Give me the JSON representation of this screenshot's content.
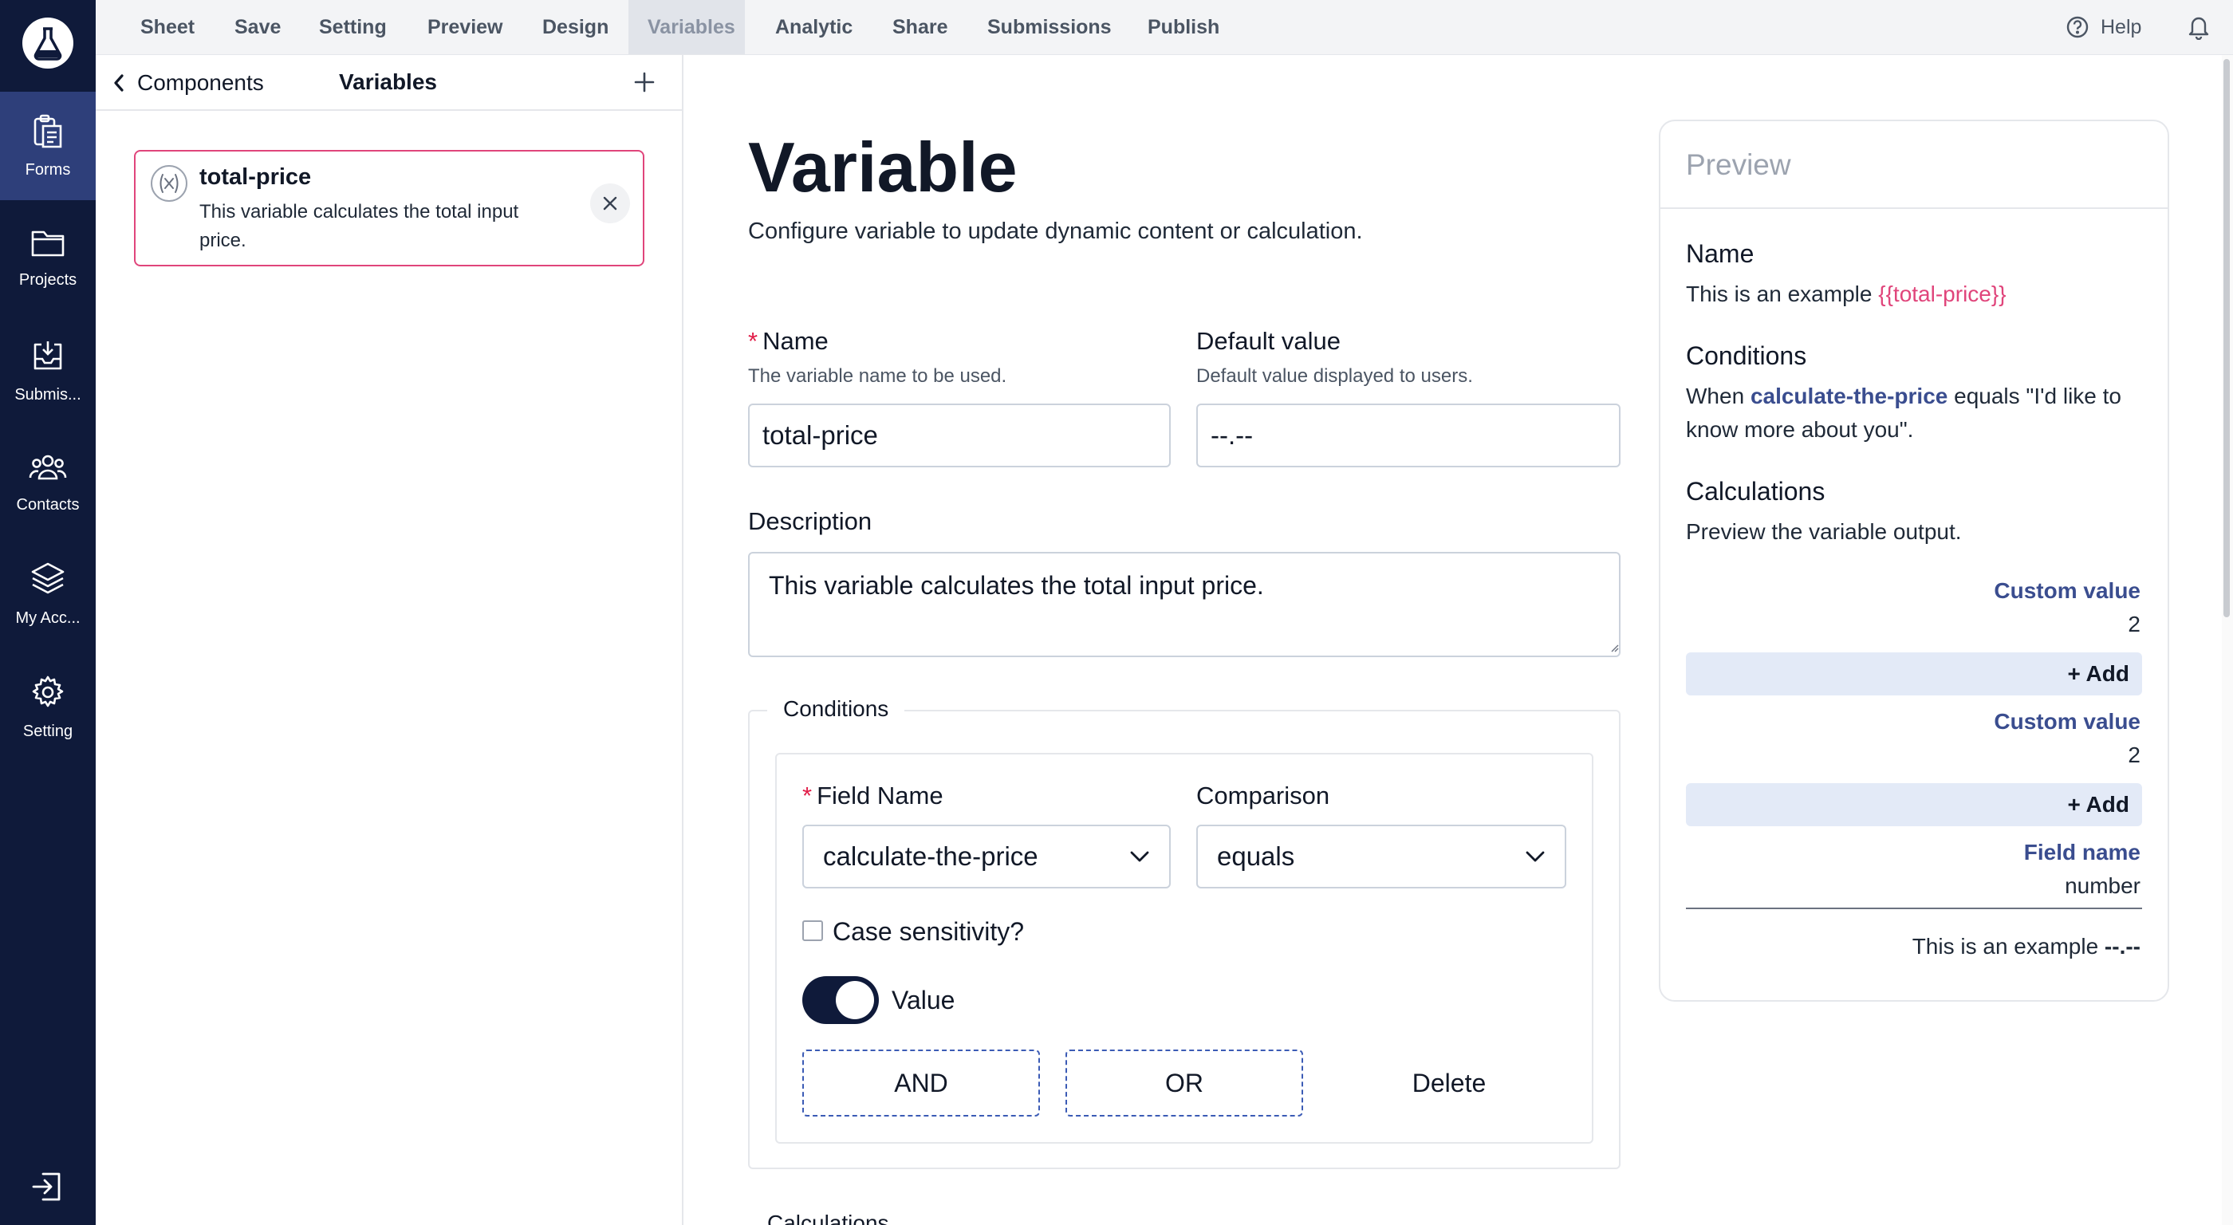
{
  "sidebar": {
    "items": [
      {
        "label": "Forms",
        "icon": "clipboard-icon"
      },
      {
        "label": "Projects",
        "icon": "folder-icon"
      },
      {
        "label": "Submis...",
        "icon": "inbox-icon"
      },
      {
        "label": "Contacts",
        "icon": "users-icon"
      },
      {
        "label": "My Acc...",
        "icon": "layers-icon"
      },
      {
        "label": "Setting",
        "icon": "gear-icon"
      }
    ]
  },
  "menu": {
    "items": [
      "Sheet",
      "Save",
      "Setting",
      "Preview",
      "Design",
      "Variables",
      "Analytic",
      "Share",
      "Submissions",
      "Publish"
    ],
    "active": "Variables",
    "help": "Help"
  },
  "panel": {
    "back": "Components",
    "title": "Variables",
    "variable": {
      "name": "total-price",
      "description": "This variable calculates the total input price."
    }
  },
  "form": {
    "title": "Variable",
    "subtitle": "Configure variable to update dynamic content or calculation.",
    "name": {
      "label": "Name",
      "hint": "The variable name to be used.",
      "value": "total-price"
    },
    "default": {
      "label": "Default value",
      "hint": "Default value displayed to users.",
      "value": "--.--"
    },
    "description": {
      "label": "Description",
      "value": "This variable calculates the total input price."
    },
    "conditions": {
      "legend": "Conditions",
      "field_label": "Field Name",
      "field_value": "calculate-the-price",
      "comparison_label": "Comparison",
      "comparison_value": "equals",
      "case_label": "Case sensitivity?",
      "value_label": "Value",
      "and": "AND",
      "or": "OR",
      "delete": "Delete"
    },
    "calculations_legend": "Calculations"
  },
  "preview": {
    "title": "Preview",
    "name_heading": "Name",
    "name_text": "This is an example",
    "name_token": "{{total-price}}",
    "conditions_heading": "Conditions",
    "cond_when": "When",
    "cond_field": "calculate-the-price",
    "cond_rest": "equals \"I'd like to know more about you\".",
    "calculations_heading": "Calculations",
    "calculations_text": "Preview the variable output.",
    "rows": [
      {
        "label": "Custom value",
        "value": "2"
      },
      {
        "label": "Custom value",
        "value": "2"
      },
      {
        "label": "Field name",
        "value": "number"
      }
    ],
    "add_label": "+ Add",
    "example_text": "This is an example",
    "example_value": "--.--"
  },
  "colors": {
    "rail": "#0f1a3a",
    "accent_pink": "#e0457b",
    "accent_blue": "#3a4d8f"
  }
}
